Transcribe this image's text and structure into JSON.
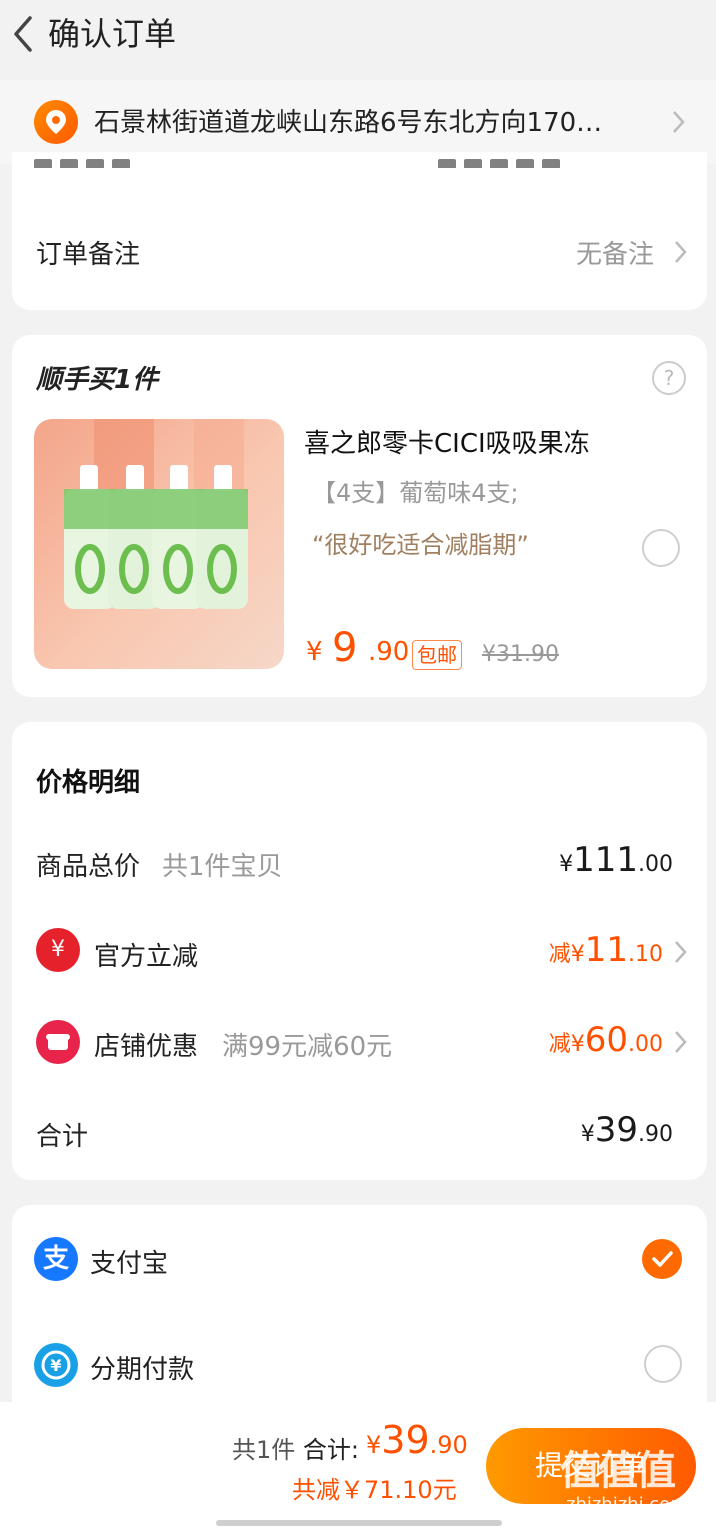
{
  "header": {
    "title": "确认订单"
  },
  "address": {
    "text": "石景林街道道龙峡山东路6号东北方向170…"
  },
  "order_note": {
    "label": "订单备注",
    "value": "无备注"
  },
  "bundle": {
    "title": "顺手买1件",
    "product": {
      "name": "喜之郎零卡CICI吸吸果冻",
      "sku": "【4支】葡萄味4支;",
      "quote": "“很好吃适合减脂期”",
      "price_currency": "¥",
      "price_int": "9",
      "price_dec": ".90",
      "shipping_tag": "包邮",
      "original_price": "¥31.90"
    }
  },
  "price_detail": {
    "title": "价格明细",
    "goods_total": {
      "label": "商品总价",
      "sub": "共1件宝贝",
      "currency": "¥",
      "int": "111",
      "dec": ".00"
    },
    "official_discount": {
      "label": "官方立减",
      "prefix": "减",
      "currency": "¥",
      "int": "11",
      "dec": ".10",
      "icon": "yen-icon"
    },
    "store_discount": {
      "label": "店铺优惠",
      "sub": "满99元减60元",
      "prefix": "减",
      "currency": "¥",
      "int": "60",
      "dec": ".00",
      "icon": "shop-icon"
    },
    "total": {
      "label": "合计",
      "currency": "¥",
      "int": "39",
      "dec": ".90"
    }
  },
  "payment": {
    "options": [
      {
        "label": "支付宝",
        "selected": true,
        "icon": "alipay-icon",
        "color": "#1677ff"
      },
      {
        "label": "分期付款",
        "selected": false,
        "icon": "installment-icon",
        "color": "#1aa0e6"
      }
    ]
  },
  "footer": {
    "count_text": "共1件",
    "total_label": "合计:",
    "currency": "¥",
    "total_int": "39",
    "total_dec": ".90",
    "saved_text": "共减￥71.10元",
    "submit_label": "提交订单",
    "watermark": "值值值",
    "watermark_url": "zhizhizhi.com"
  },
  "colors": {
    "accent": "#ff5000",
    "alipay": "#1677ff",
    "discount_red": "#e5222b"
  }
}
